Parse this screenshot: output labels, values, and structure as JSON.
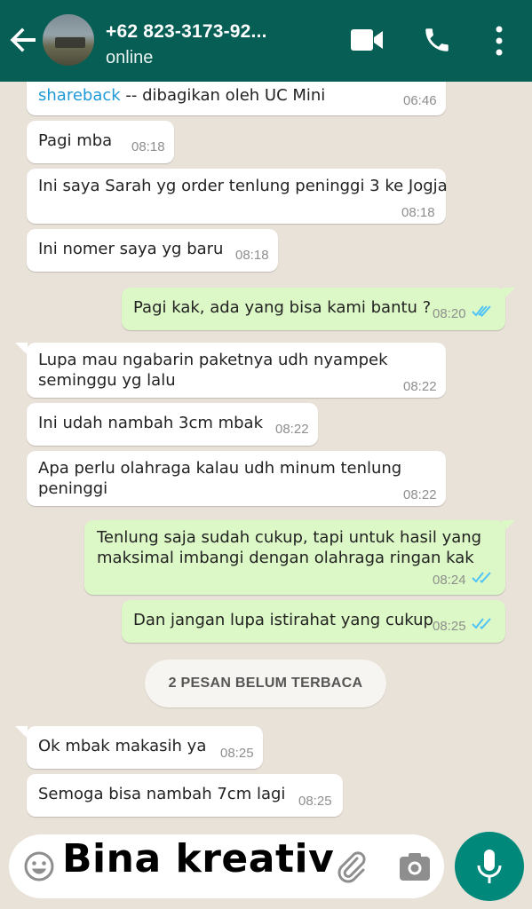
{
  "header": {
    "contact_name": "+62 823-3173-92...",
    "status": "online",
    "bg_color": "#075e54"
  },
  "messages": [
    {
      "dir": "in",
      "text": "shareback -- dibagikan oleh UC Mini",
      "link": "shareback",
      "rest": " -- dibagikan oleh UC Mini",
      "time": "06:46"
    },
    {
      "dir": "in",
      "text": "Pagi mba",
      "time": "08:18"
    },
    {
      "dir": "in",
      "text": "Ini saya Sarah yg order tenlung peninggi 3 ke Jogja",
      "time": "08:18"
    },
    {
      "dir": "in",
      "text": "Ini nomer saya yg baru",
      "time": "08:18"
    },
    {
      "dir": "out",
      "text": "Pagi kak, ada yang bisa kami bantu ?",
      "time": "08:20",
      "read": true
    },
    {
      "dir": "in",
      "lines": [
        "Lupa mau ngabarin paketnya udh nyampek",
        "seminggu yg lalu"
      ],
      "time": "08:22"
    },
    {
      "dir": "in",
      "text": "Ini udah nambah 3cm mbak",
      "time": "08:22"
    },
    {
      "dir": "in",
      "lines": [
        "Apa perlu olahraga kalau udh minum tenlung",
        "peninggi"
      ],
      "time": "08:22"
    },
    {
      "dir": "out",
      "lines": [
        "Tenlung saja sudah cukup, tapi untuk hasil yang",
        "maksimal imbangi dengan olahraga ringan kak"
      ],
      "time": "08:24",
      "read": true
    },
    {
      "dir": "out",
      "text": "Dan jangan lupa istirahat yang cukup",
      "time": "08:25",
      "read": true
    },
    {
      "dir": "in",
      "text": "Ok mbak makasih ya",
      "time": "08:25"
    },
    {
      "dir": "in",
      "text": "Semoga bisa nambah 7cm lagi",
      "time": "08:25"
    }
  ],
  "unread_label": "2 PESAN BELUM TERBACA",
  "input": {
    "value": "",
    "placeholder": ""
  },
  "watermark": "Bina kreativ",
  "colors": {
    "incoming": "#ffffff",
    "outgoing": "#dcf8c6",
    "read_tick": "#4fc3f7",
    "mic_button": "#00897b"
  },
  "icons": [
    "back-arrow-icon",
    "video-call-icon",
    "phone-icon",
    "more-vert-icon",
    "emoji-icon",
    "paperclip-icon",
    "camera-icon",
    "mic-icon",
    "double-check-icon"
  ]
}
